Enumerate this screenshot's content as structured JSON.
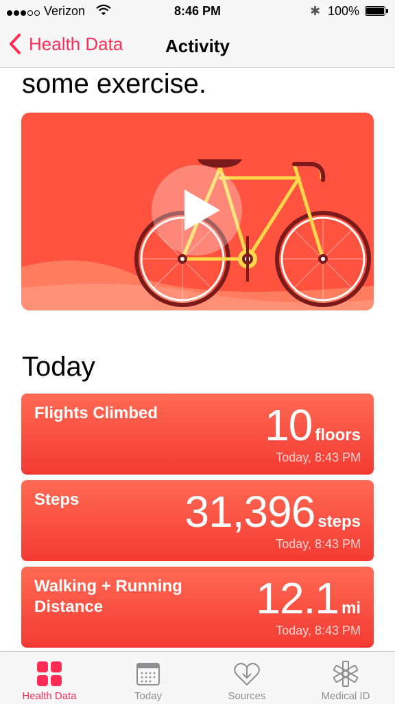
{
  "status_bar": {
    "carrier": "Verizon",
    "time": "8:46 PM",
    "battery_percent": "100%"
  },
  "nav": {
    "back_label": "Health Data",
    "title": "Activity"
  },
  "intro_text": "some exercise.",
  "section_title": "Today",
  "records": [
    {
      "label": "Flights Climbed",
      "value": "10",
      "unit": "floors",
      "timestamp": "Today, 8:43 PM"
    },
    {
      "label": "Steps",
      "value": "31,396",
      "unit": "steps",
      "timestamp": "Today, 8:43 PM"
    },
    {
      "label": "Walking + Running Distance",
      "value": "12.1",
      "unit": "mi",
      "timestamp": "Today, 8:43 PM"
    }
  ],
  "tabs": [
    {
      "label": "Health Data",
      "icon": "grid-icon",
      "active": true
    },
    {
      "label": "Today",
      "icon": "calendar-icon",
      "active": false
    },
    {
      "label": "Sources",
      "icon": "heart-download-icon",
      "active": false
    },
    {
      "label": "Medical ID",
      "icon": "asterisk-icon",
      "active": false
    }
  ],
  "colors": {
    "accent": "#ff2d55",
    "card": "#f5483a",
    "video_bg": "#ff533f"
  }
}
